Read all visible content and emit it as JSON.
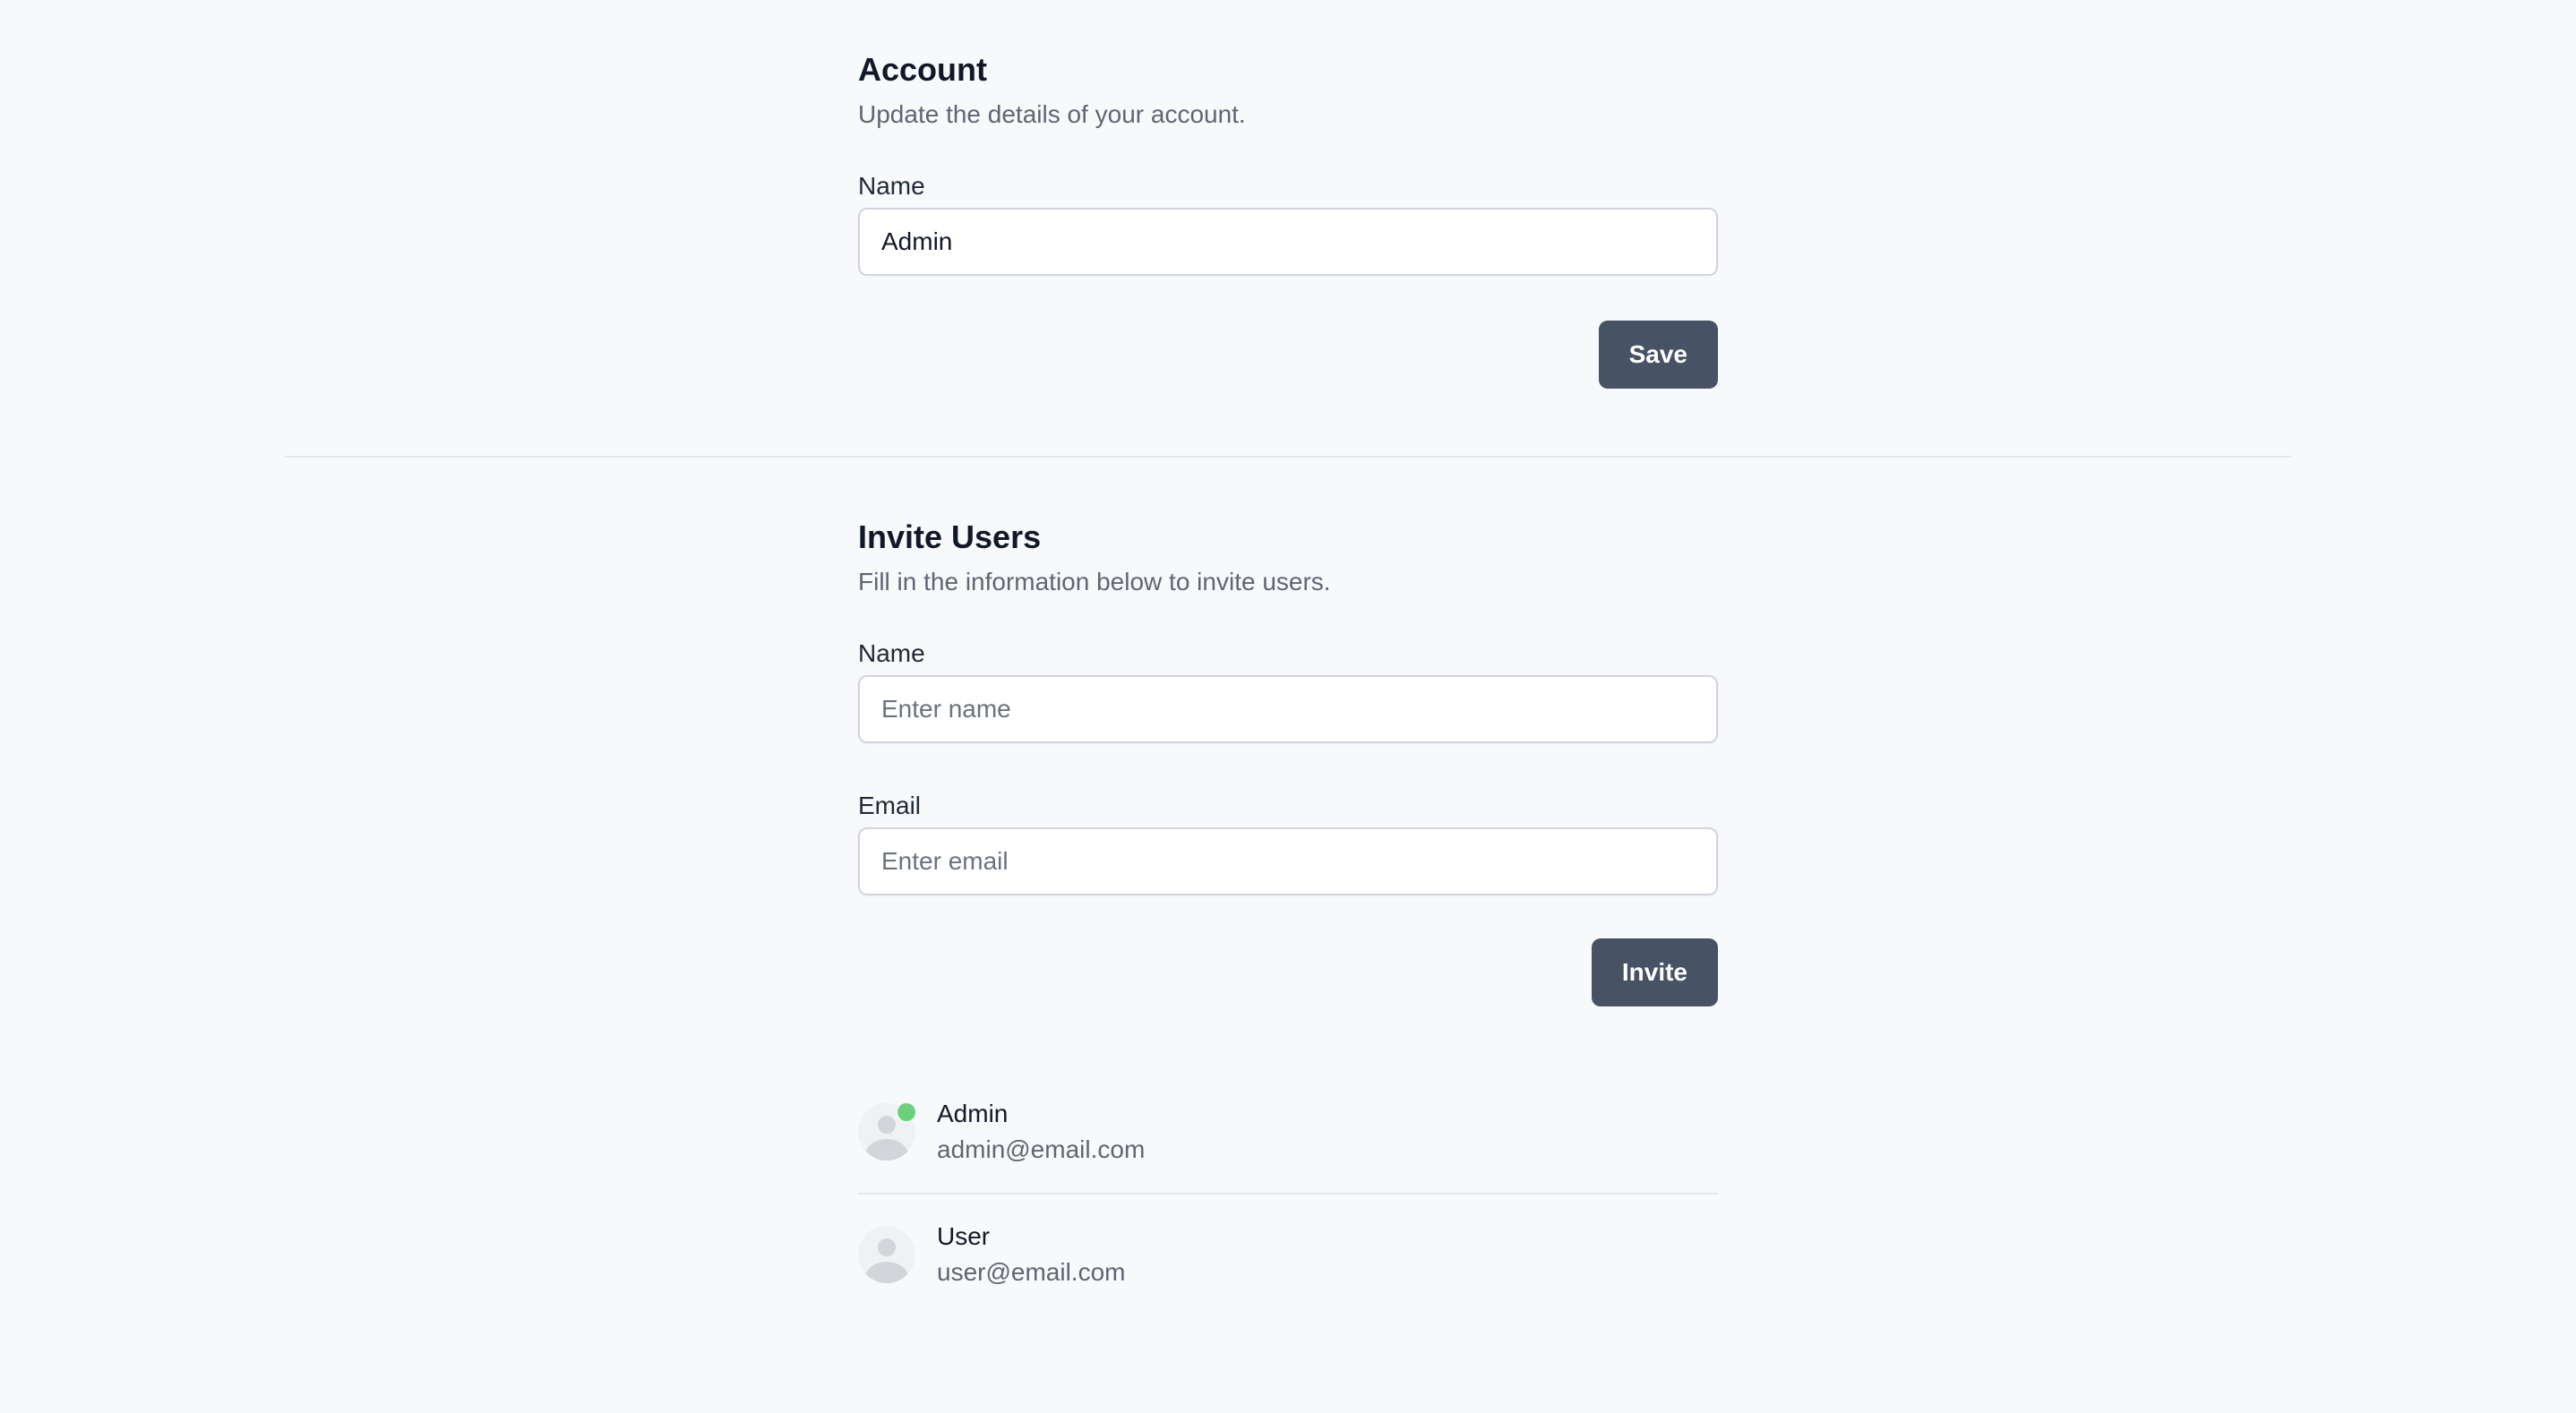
{
  "account": {
    "title": "Account",
    "description": "Update the details of your account.",
    "name_label": "Name",
    "name_value": "Admin",
    "save_label": "Save"
  },
  "invite": {
    "title": "Invite Users",
    "description": "Fill in the information below to invite users.",
    "name_label": "Name",
    "name_placeholder": "Enter name",
    "email_label": "Email",
    "email_placeholder": "Enter email",
    "invite_label": "Invite"
  },
  "users": [
    {
      "name": "Admin",
      "email": "admin@email.com",
      "online": true
    },
    {
      "name": "User",
      "email": "user@email.com",
      "online": false
    }
  ],
  "colors": {
    "background": "#f8f9fb",
    "button": "#475264",
    "online_status": "#6bd07b"
  }
}
